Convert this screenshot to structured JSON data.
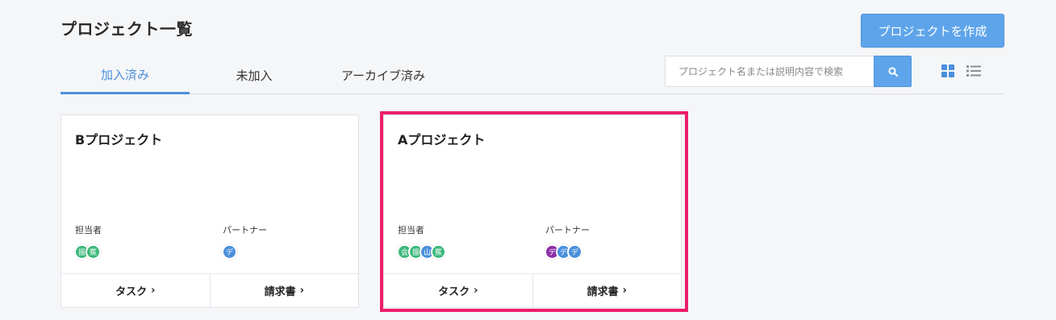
{
  "header": {
    "title": "プロジェクト一覧",
    "create_label": "プロジェクトを作成"
  },
  "tabs": [
    {
      "label": "加入済み",
      "active": true
    },
    {
      "label": "未加入",
      "active": false
    },
    {
      "label": "アーカイブ済み",
      "active": false
    }
  ],
  "search": {
    "placeholder": "プロジェクト名または説明内容で検索",
    "button_icon": "search-icon"
  },
  "view_toggle": {
    "grid_icon": "grid-view-icon",
    "list_icon": "list-view-icon"
  },
  "cards": [
    {
      "title": "Bプロジェクト",
      "assignee_label": "担当者",
      "partner_label": "パートナー",
      "assignees": [
        {
          "initial": "振",
          "color": "#3bb87a"
        },
        {
          "initial": "蕉",
          "color": "#3bb87a"
        }
      ],
      "partners": [
        {
          "initial": "デ",
          "color": "#4a8fdb"
        }
      ],
      "task_label": "タスク",
      "invoice_label": "請求書"
    },
    {
      "title": "Aプロジェクト",
      "assignee_label": "担当者",
      "partner_label": "パートナー",
      "assignees": [
        {
          "initial": "会",
          "color": "#3bb87a"
        },
        {
          "initial": "振",
          "color": "#3bb87a"
        },
        {
          "initial": "山",
          "color": "#4a8fdb"
        },
        {
          "initial": "蕉",
          "color": "#3bb87a"
        }
      ],
      "partners": [
        {
          "initial": "デ",
          "color": "#8e2ea8"
        },
        {
          "initial": "デ",
          "color": "#4a8fdb"
        },
        {
          "initial": "デ",
          "color": "#4a8fdb"
        }
      ],
      "task_label": "タスク",
      "invoice_label": "請求書"
    }
  ],
  "colors": {
    "accent": "#5ea4ea",
    "active_tab": "#4a8fdb",
    "highlight": "#ec1e6a"
  }
}
